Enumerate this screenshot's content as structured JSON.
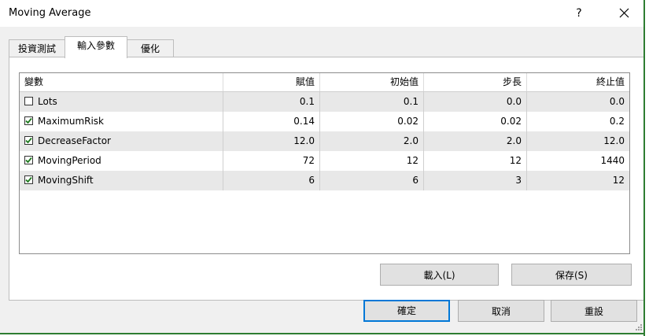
{
  "window": {
    "title": "Moving Average",
    "help_label": "?"
  },
  "tabs": [
    {
      "label": "投資測試",
      "active": false
    },
    {
      "label": "輸入參數",
      "active": true
    },
    {
      "label": "優化",
      "active": false
    }
  ],
  "grid": {
    "columns": [
      "變數",
      "賦值",
      "初始值",
      "步長",
      "終止值"
    ],
    "rows": [
      {
        "checked": false,
        "name": "Lots",
        "value": "0.1",
        "start": "0.1",
        "step": "0.0",
        "stop": "0.0"
      },
      {
        "checked": true,
        "name": "MaximumRisk",
        "value": "0.14",
        "start": "0.02",
        "step": "0.02",
        "stop": "0.2"
      },
      {
        "checked": true,
        "name": "DecreaseFactor",
        "value": "12.0",
        "start": "2.0",
        "step": "2.0",
        "stop": "12.0"
      },
      {
        "checked": true,
        "name": "MovingPeriod",
        "value": "72",
        "start": "12",
        "step": "12",
        "stop": "1440"
      },
      {
        "checked": true,
        "name": "MovingShift",
        "value": "6",
        "start": "6",
        "step": "3",
        "stop": "12"
      }
    ]
  },
  "buttons": {
    "load": "載入(L)",
    "save": "保存(S)",
    "ok": "確定",
    "cancel": "取消",
    "reset": "重設"
  },
  "colors": {
    "check_mark": "#1e7a1e",
    "focus_border": "#0078d7",
    "frame_accent": "#2e7d32"
  }
}
